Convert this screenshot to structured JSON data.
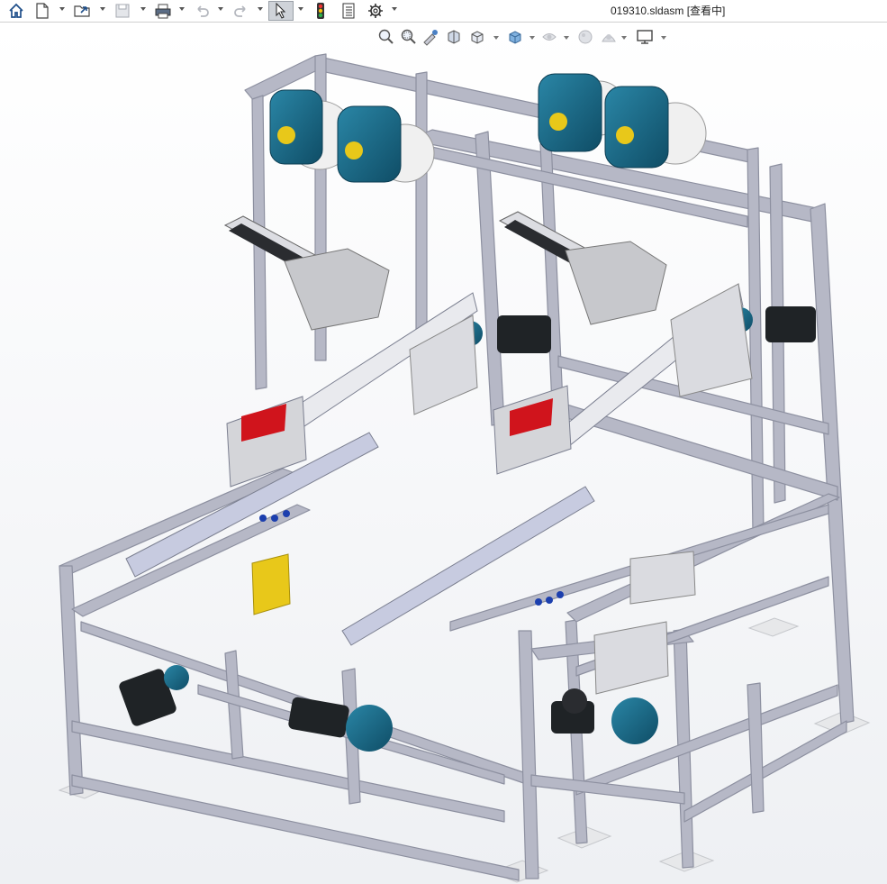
{
  "window": {
    "title": "019310.sldasm [查看中]"
  },
  "toolbar": {
    "items": [
      {
        "name": "home",
        "icon": "home-icon"
      },
      {
        "name": "new",
        "icon": "new-document-icon"
      },
      {
        "name": "open",
        "icon": "open-folder-icon"
      },
      {
        "name": "save",
        "icon": "save-icon"
      },
      {
        "name": "print",
        "icon": "print-icon"
      },
      {
        "name": "undo",
        "icon": "undo-icon"
      },
      {
        "name": "redo",
        "icon": "redo-icon"
      },
      {
        "name": "select",
        "icon": "select-cursor-icon"
      },
      {
        "name": "rebuild",
        "icon": "traffic-light-icon"
      },
      {
        "name": "file-properties",
        "icon": "file-properties-icon"
      },
      {
        "name": "options",
        "icon": "gear-icon"
      }
    ]
  },
  "view_toolbar": {
    "items": [
      {
        "name": "zoom-to-fit",
        "icon": "zoom-fit-icon"
      },
      {
        "name": "zoom-to-area",
        "icon": "zoom-area-icon"
      },
      {
        "name": "previous-view",
        "icon": "previous-view-icon"
      },
      {
        "name": "section-view",
        "icon": "section-view-icon"
      },
      {
        "name": "view-orientation",
        "icon": "view-orientation-icon"
      },
      {
        "name": "display-style",
        "icon": "display-style-icon"
      },
      {
        "name": "hide-show-items",
        "icon": "hide-show-icon"
      },
      {
        "name": "edit-appearance",
        "icon": "appearance-icon"
      },
      {
        "name": "apply-scene",
        "icon": "scene-icon"
      },
      {
        "name": "view-settings",
        "icon": "monitor-icon"
      }
    ]
  },
  "colors": {
    "frame": "#b6b8c6",
    "frame_dark": "#8d90a0",
    "motor_teal": "#1d6f8c",
    "motor_black": "#1f2326",
    "red_part": "#d0141c",
    "yellow_part": "#e8c81a",
    "accent_selected": "#cfd3d9"
  }
}
